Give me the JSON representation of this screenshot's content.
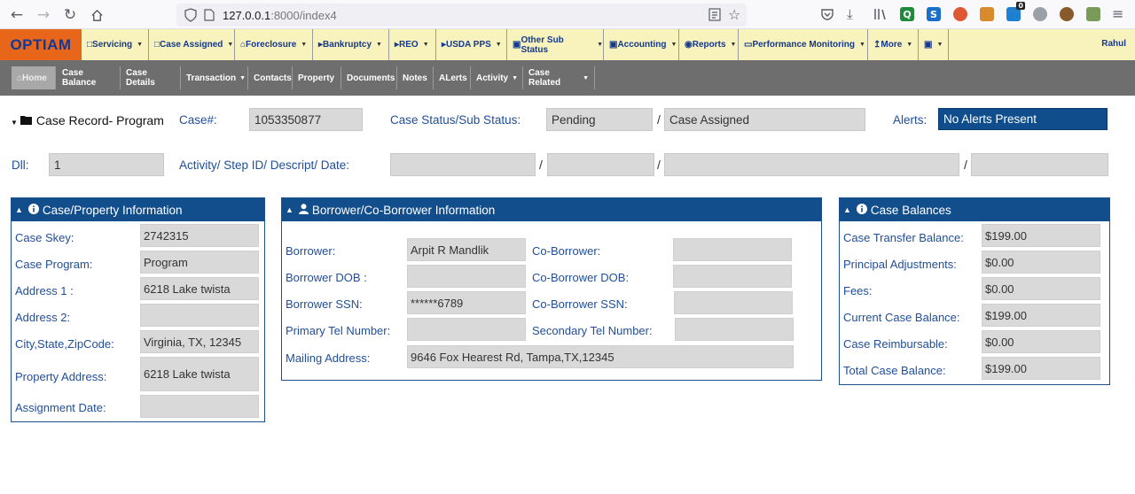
{
  "browser": {
    "url_host": "127.0.0.1",
    "url_rest": ":8000/index4",
    "extension_letters": {
      "q": "Q",
      "s": "S",
      "badge": "0"
    }
  },
  "app": {
    "logo": "OPTIAM",
    "user": "Rahul",
    "top_menu": [
      "Servicing",
      "Case Assigned",
      "Foreclosure",
      "Bankruptcy",
      "REO",
      "USDA PPS",
      "Other Sub Status",
      "Accounting",
      "Reports",
      "Performance Monitoring",
      "More"
    ],
    "sub_menu": [
      "Home",
      "Case Balance",
      "Case Details",
      "Transaction",
      "Contacts",
      "Property",
      "Documents",
      "Notes",
      "ALerts",
      "Activity",
      "Case Related"
    ]
  },
  "record": {
    "title": "Case Record- Program",
    "case_label": "Case#:",
    "case_value": "1053350877",
    "status_label": "Case Status/Sub Status:",
    "status_value": "Pending",
    "sep": "/",
    "substatus_value": "Case Assigned",
    "alerts_label": "Alerts:",
    "alerts_value": "No Alerts Present",
    "dil_label": "Dll:",
    "dil_value": "1",
    "activity_label": "Activity/ Step ID/ Descript/ Date:"
  },
  "case_property": {
    "title": "Case/Property Information",
    "rows": [
      {
        "label": "Case Skey:",
        "value": "2742315"
      },
      {
        "label": "Case Program:",
        "value": "Program"
      },
      {
        "label": "Address 1 :",
        "value": "6218 Lake twista"
      },
      {
        "label": "Address 2:",
        "value": ""
      },
      {
        "label": "City,State,ZipCode:",
        "value": "Virginia, TX, 12345"
      },
      {
        "label": "Property Address:",
        "value": "6218 Lake twista"
      },
      {
        "label": "Assignment Date:",
        "value": ""
      }
    ]
  },
  "borrower": {
    "title": "Borrower/Co-Borrower Information",
    "rows": [
      {
        "label": "Borrower:",
        "value": "Arpit R Mandlik",
        "co_label": "Co-Borrower:",
        "co_value": ""
      },
      {
        "label": "Borrower DOB :",
        "value": "",
        "co_label": "Co-Borrower DOB:",
        "co_value": ""
      },
      {
        "label": "Borrower SSN:",
        "value": "******6789",
        "co_label": "Co-Borrower SSN:",
        "co_value": ""
      },
      {
        "label": "Primary Tel Number:",
        "value": "",
        "co_label": "Secondary Tel Number:",
        "co_value": ""
      }
    ],
    "mailing_label": "Mailing Address:",
    "mailing_value": "9646 Fox Hearest Rd, Tampa,TX,12345"
  },
  "balances": {
    "title": "Case Balances",
    "rows": [
      {
        "label": "Case Transfer Balance:",
        "value": "$199.00"
      },
      {
        "label": "Principal Adjustments:",
        "value": "$0.00"
      },
      {
        "label": "Fees:",
        "value": "$0.00"
      },
      {
        "label": "Current Case Balance:",
        "value": "$199.00"
      },
      {
        "label": "Case Reimbursable:",
        "value": "$0.00"
      },
      {
        "label": "Total Case Balance:",
        "value": "$199.00"
      }
    ]
  }
}
